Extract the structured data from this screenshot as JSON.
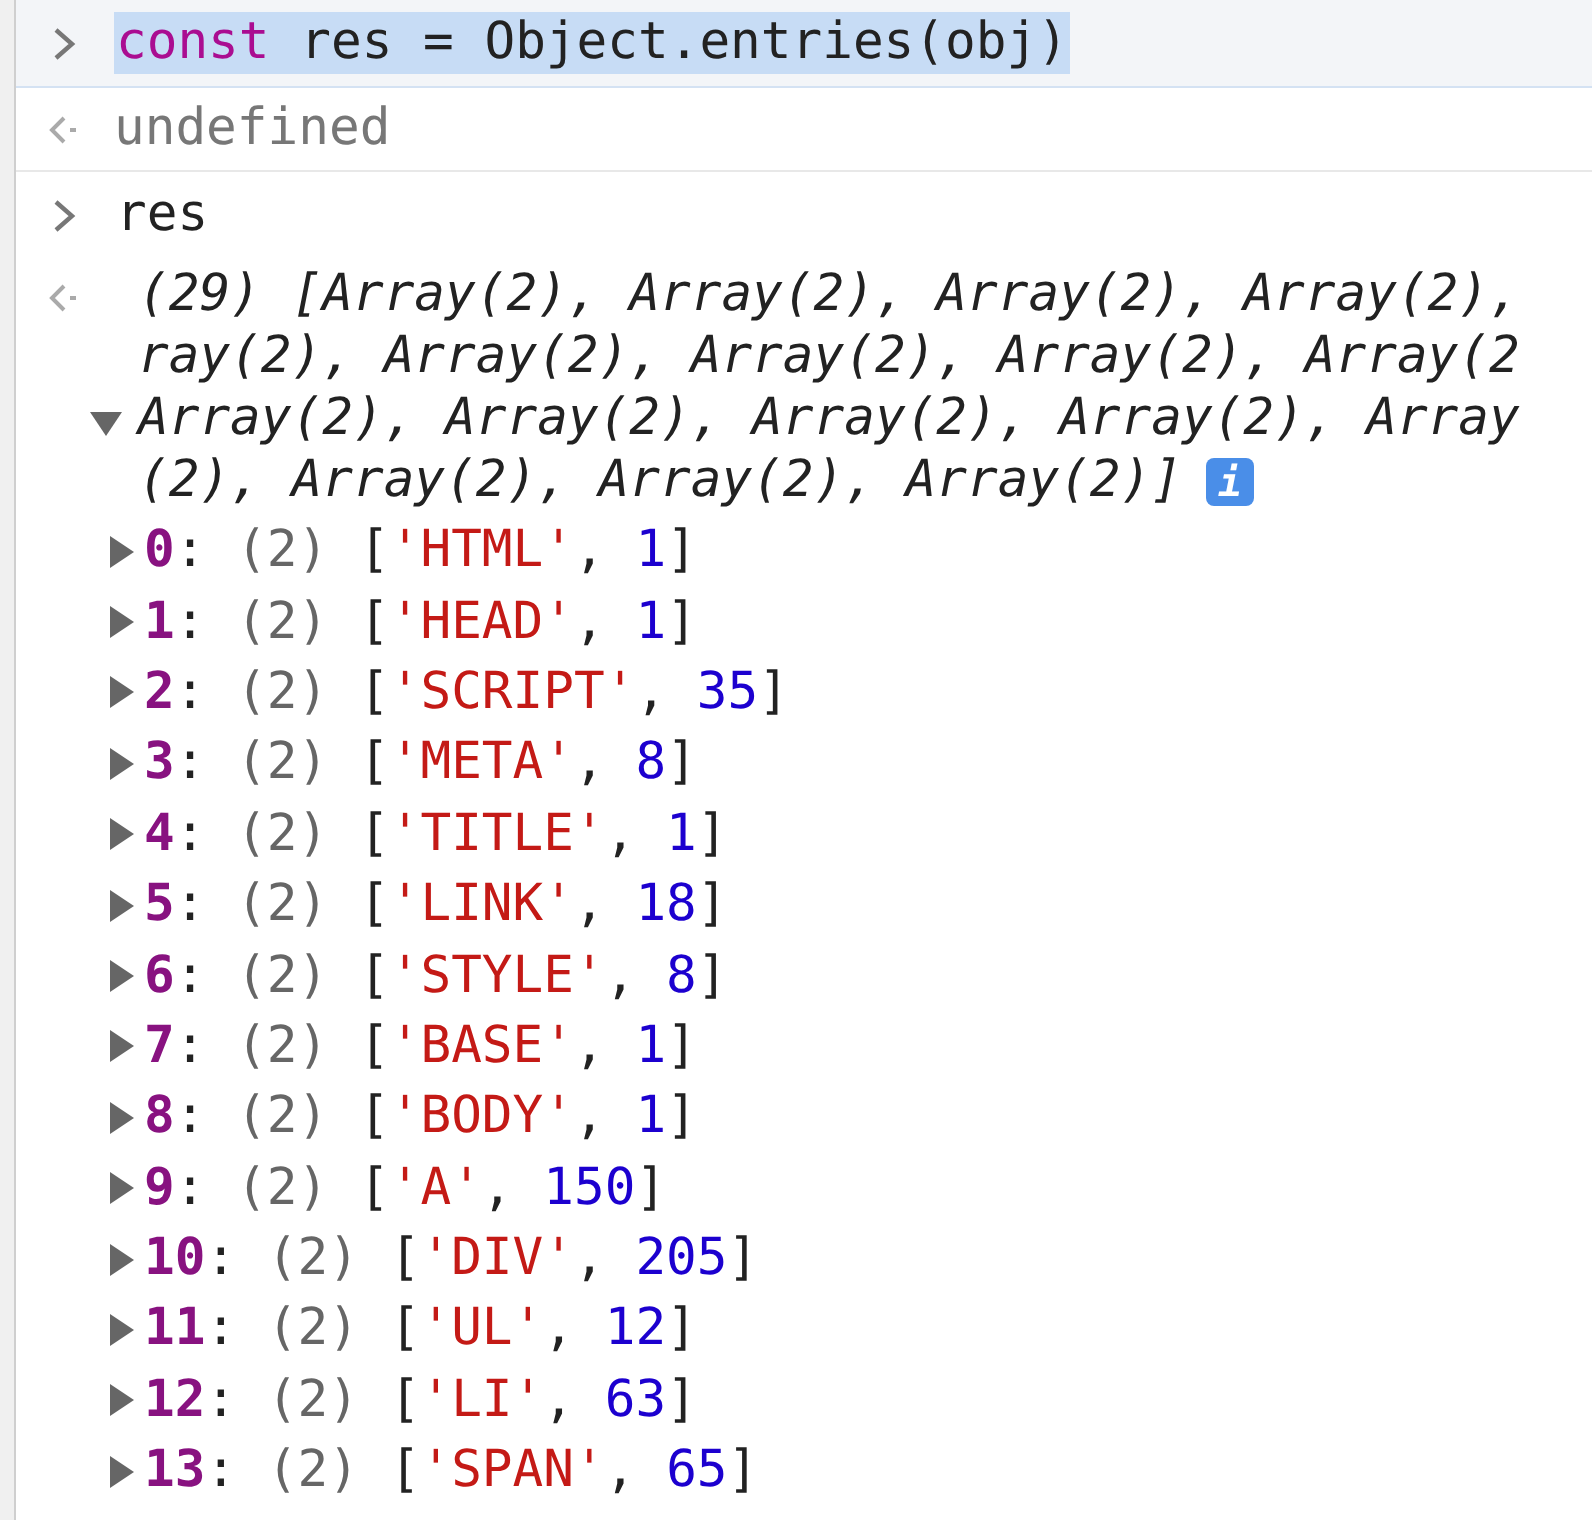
{
  "console": [
    {
      "kind": "input",
      "code": [
        {
          "kind": "keyword",
          "text": "const"
        },
        {
          "kind": "plain",
          "text": " res = Object.entries(obj)"
        }
      ],
      "selected": true
    },
    {
      "kind": "output",
      "text": "undefined"
    },
    {
      "kind": "input",
      "code": [
        {
          "kind": "plain",
          "text": "res"
        }
      ],
      "selected": false
    },
    {
      "kind": "array",
      "expanded": true,
      "summary_lines": [
        "(29) [Array(2), Array(2), Array(2), Array(2),",
        "ray(2), Array(2), Array(2), Array(2), Array(2",
        "Array(2), Array(2), Array(2), Array(2), Array",
        "(2), Array(2), Array(2), Array(2)]"
      ],
      "info_icon": "i",
      "items": [
        {
          "parts": [
            "0",
            ": ",
            "(2)",
            " [",
            "'HTML'",
            ", ",
            "1",
            "]"
          ]
        },
        {
          "parts": [
            "1",
            ": ",
            "(2)",
            " [",
            "'HEAD'",
            ", ",
            "1",
            "]"
          ]
        },
        {
          "parts": [
            "2",
            ": ",
            "(2)",
            " [",
            "'SCRIPT'",
            ", ",
            "35",
            "]"
          ]
        },
        {
          "parts": [
            "3",
            ": ",
            "(2)",
            " [",
            "'META'",
            ", ",
            "8",
            "]"
          ]
        },
        {
          "parts": [
            "4",
            ": ",
            "(2)",
            " [",
            "'TITLE'",
            ", ",
            "1",
            "]"
          ]
        },
        {
          "parts": [
            "5",
            ": ",
            "(2)",
            " [",
            "'LINK'",
            ", ",
            "18",
            "]"
          ]
        },
        {
          "parts": [
            "6",
            ": ",
            "(2)",
            " [",
            "'STYLE'",
            ", ",
            "8",
            "]"
          ]
        },
        {
          "parts": [
            "7",
            ": ",
            "(2)",
            " [",
            "'BASE'",
            ", ",
            "1",
            "]"
          ]
        },
        {
          "parts": [
            "8",
            ": ",
            "(2)",
            " [",
            "'BODY'",
            ", ",
            "1",
            "]"
          ]
        },
        {
          "parts": [
            "9",
            ": ",
            "(2)",
            " [",
            "'A'",
            ", ",
            "150",
            "]"
          ]
        },
        {
          "parts": [
            "10",
            ": ",
            "(2)",
            " [",
            "'DIV'",
            ", ",
            "205",
            "]"
          ]
        },
        {
          "parts": [
            "11",
            ": ",
            "(2)",
            " [",
            "'UL'",
            ", ",
            "12",
            "]"
          ]
        },
        {
          "parts": [
            "12",
            ": ",
            "(2)",
            " [",
            "'LI'",
            ", ",
            "63",
            "]"
          ]
        },
        {
          "parts": [
            "13",
            ": ",
            "(2)",
            " [",
            "'SPAN'",
            ", ",
            "65",
            "]"
          ]
        }
      ]
    }
  ]
}
